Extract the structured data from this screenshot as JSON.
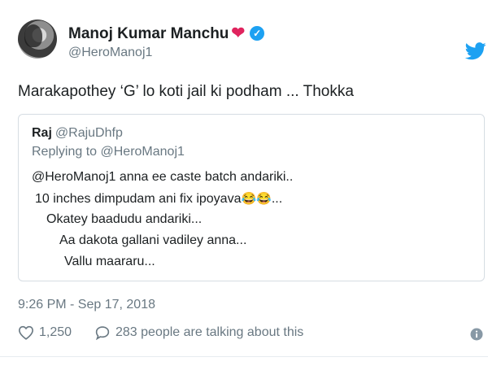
{
  "author": {
    "name": "Manoj Kumar Manchu",
    "heart": "❤",
    "handle": "@HeroManoj1"
  },
  "icons": {
    "platform": "twitter-bird-icon",
    "verified": "verified-badge-icon",
    "like": "heart-outline-icon",
    "reply": "speech-bubble-icon",
    "info": "info-icon"
  },
  "colors": {
    "accent": "#1da1f2",
    "heart": "#e0245e",
    "secondary_text": "#697882"
  },
  "tweet": {
    "text": "Marakapothey ‘G’ lo koti jail ki podham ... Thokka"
  },
  "quoted": {
    "name": "Raj",
    "handle": "@RajuDhfp",
    "replying_to": "Replying to @HeroManoj1",
    "lines": [
      "@HeroManoj1 anna ee caste batch andariki..",
      "10 inches dimpudam ani fix ipoyava",
      "Okatey baadudu andariki...",
      "Aa dakota gallani vadiley anna...",
      "Vallu maararu..."
    ],
    "line2_emojis": "😂😂",
    "line2_suffix": "..."
  },
  "meta": {
    "timestamp": "9:26 PM - Sep 17, 2018",
    "likes": "1,250",
    "talking": "283 people are talking about this"
  }
}
